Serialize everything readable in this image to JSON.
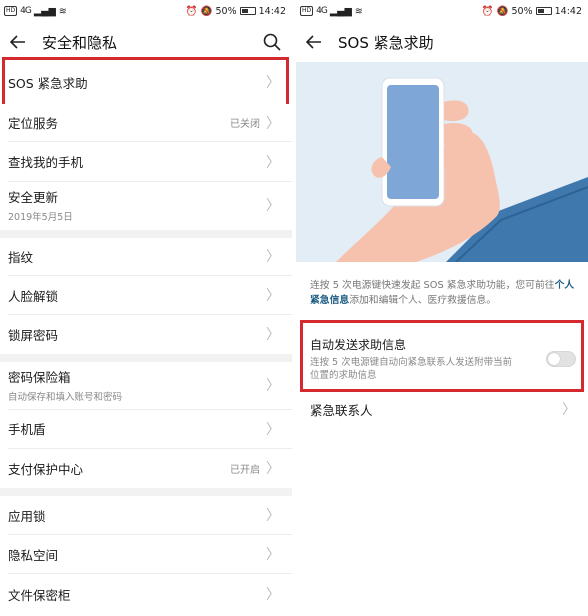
{
  "status_bar": {
    "network_chip": "HD",
    "signal": "4G",
    "battery_percent": "50%",
    "time": "14:42"
  },
  "colors": {
    "highlight": "#d42a2f",
    "link": "#1e5d86",
    "illustration_bg": "#e3edf5",
    "phone_screen": "#7ea6d6",
    "sleeve": "#3e78ad"
  },
  "left_screen": {
    "title": "安全和隐私",
    "back_icon": "arrow-left-icon",
    "search_icon": "search-icon",
    "items": [
      {
        "label": "SOS 紧急求助"
      },
      {
        "label": "定位服务",
        "value": "已关闭"
      },
      {
        "label": "查找我的手机"
      },
      {
        "label": "安全更新",
        "sub": "2019年5月5日"
      },
      {
        "label": "指纹"
      },
      {
        "label": "人脸解锁"
      },
      {
        "label": "锁屏密码"
      },
      {
        "label": "密码保险箱",
        "sub": "自动保存和填入账号和密码"
      },
      {
        "label": "手机盾"
      },
      {
        "label": "支付保护中心",
        "value": "已开启"
      },
      {
        "label": "应用锁"
      },
      {
        "label": "隐私空间"
      },
      {
        "label": "文件保密柜"
      }
    ]
  },
  "right_screen": {
    "title": "SOS 紧急求助",
    "description_before": "连按 5 次电源键快速发起 SOS 紧急求助功能，您可前往",
    "description_link": "个人紧急信息",
    "description_after": "添加和编辑个人、医疗救援信息。",
    "auto_send": {
      "label": "自动发送求助信息",
      "sub": "连按 5 次电源键自动向紧急联系人发送附带当前位置的求助信息",
      "enabled": false
    },
    "emergency_contacts": {
      "label": "紧急联系人"
    }
  },
  "chevron": "〉"
}
